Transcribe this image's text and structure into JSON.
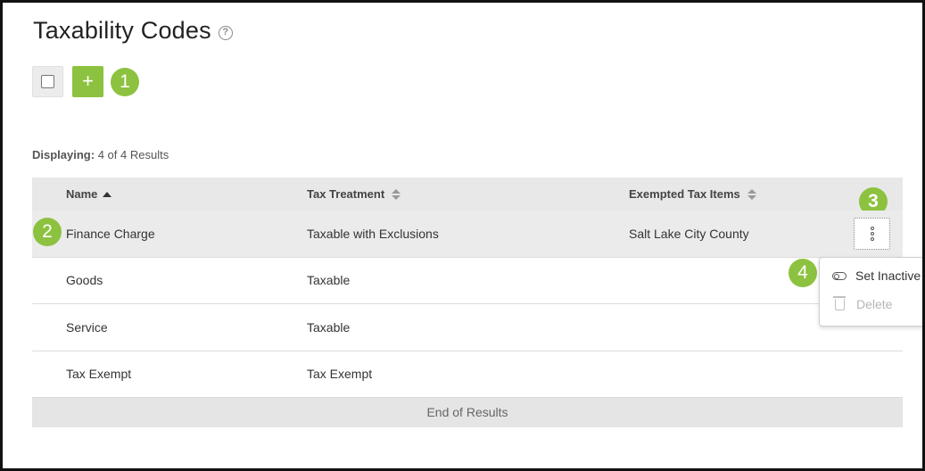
{
  "header": {
    "title": "Taxability Codes",
    "help_glyph": "?"
  },
  "toolbar": {
    "add_label": "+"
  },
  "callouts": [
    "1",
    "2",
    "3",
    "4"
  ],
  "results": {
    "label": "Displaying:",
    "count_text": "4 of 4 Results"
  },
  "table": {
    "columns": [
      "Name",
      "Tax Treatment",
      "Exempted Tax Items"
    ],
    "rows": [
      {
        "name": "Finance Charge",
        "treatment": "Taxable with Exclusions",
        "exempted": "Salt Lake City County"
      },
      {
        "name": "Goods",
        "treatment": "Taxable",
        "exempted": ""
      },
      {
        "name": "Service",
        "treatment": "Taxable",
        "exempted": ""
      },
      {
        "name": "Tax Exempt",
        "treatment": "Tax Exempt",
        "exempted": ""
      }
    ],
    "footer": "End of Results"
  },
  "row_menu": {
    "set_inactive": "Set Inactive",
    "delete": "Delete"
  },
  "colors": {
    "accent": "#8cc23f",
    "header_bg": "#e8e8e8",
    "row_highlight": "#ebebeb"
  },
  "icons": [
    "help-icon",
    "checkbox-icon",
    "plus-icon",
    "sort-ascending-icon",
    "sort-icon",
    "kebab-menu-icon",
    "toggle-icon",
    "trash-icon"
  ]
}
